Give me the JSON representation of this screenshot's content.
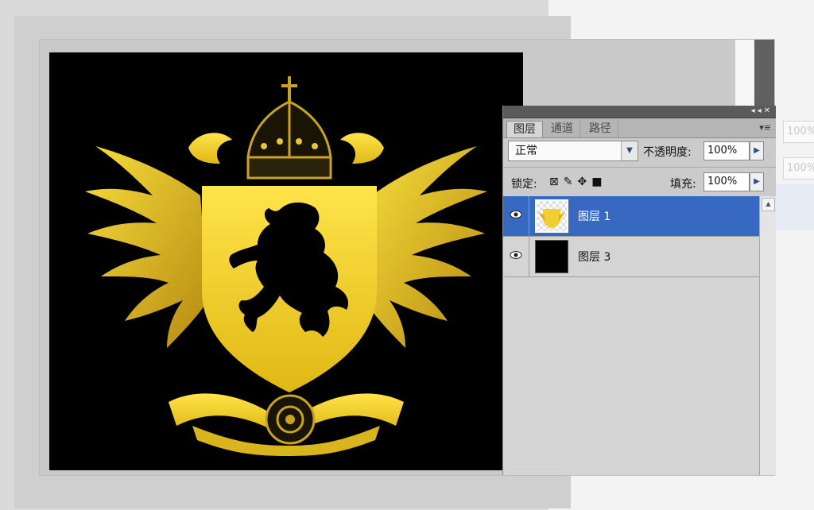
{
  "layers_panel": {
    "tabs": [
      {
        "label": "图层",
        "active": true
      },
      {
        "label": "通道",
        "active": false
      },
      {
        "label": "路径",
        "active": false
      }
    ],
    "blend_mode": "正常",
    "opacity_label": "不透明度:",
    "opacity_value": "100%",
    "lock_label": "锁定:",
    "fill_label": "填充:",
    "fill_value": "100%",
    "layers": [
      {
        "name": "图层 1",
        "selected": true,
        "visible": true,
        "thumb": "crest-thumbnail"
      },
      {
        "name": "图层 3",
        "selected": false,
        "visible": true,
        "thumb": "black-thumbnail"
      }
    ]
  },
  "background_fields": {
    "opacity_ghost": "100%",
    "fill_ghost": "100%"
  },
  "colors": {
    "selection": "#3769c0",
    "crest_gold": "#f4d31e",
    "canvas_bg": "#000000"
  },
  "icons": [
    "eye-icon",
    "lock-transparency-icon",
    "brush-icon",
    "move-icon",
    "lock-icon",
    "panel-menu-icon",
    "collapse-icon",
    "close-icon"
  ]
}
